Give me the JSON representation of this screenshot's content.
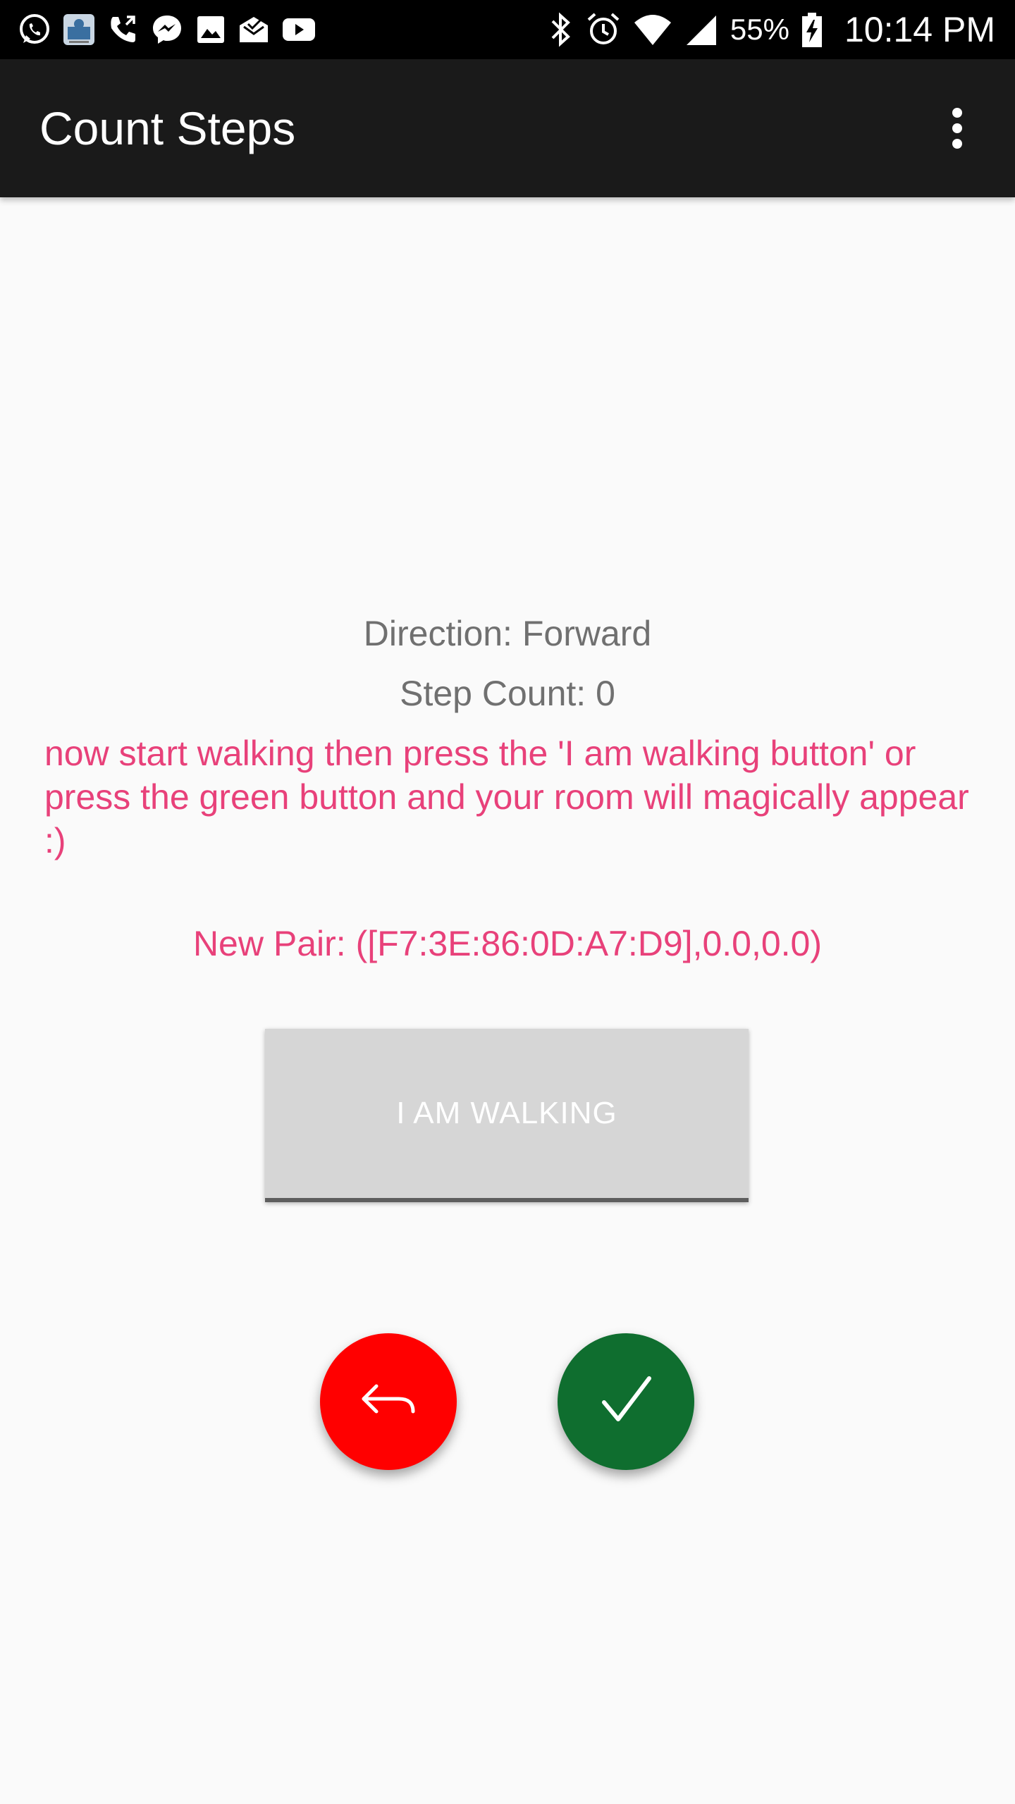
{
  "status_bar": {
    "battery_percent": "55%",
    "time": "10:14 PM",
    "icons": [
      "whatsapp-icon",
      "app-thumbnail-icon",
      "phone-call-icon",
      "messenger-icon",
      "gallery-icon",
      "mail-icon",
      "youtube-icon",
      "bluetooth-icon",
      "alarm-icon",
      "wifi-icon",
      "signal-icon",
      "battery-icon"
    ]
  },
  "app_bar": {
    "title": "Count Steps",
    "menu_icon": "more-vert-icon"
  },
  "main": {
    "direction": "Direction: Forward",
    "step_count": "Step Count: 0",
    "instruction": "now start walking  then press the 'I am walking button' or press the green button and your room will magically appear :)",
    "new_pair": "New Pair: ([F7:3E:86:0D:A7:D9],0.0,0.0)",
    "walk_button_label": "I AM WALKING"
  },
  "fabs": {
    "back_icon": "reply-arrow-icon",
    "confirm_icon": "checkmark-icon"
  },
  "colors": {
    "status_bar_bg": "#000000",
    "app_bar_bg": "#1a1a1a",
    "page_bg": "#fafafa",
    "info_text": "#707070",
    "accent_pink": "#e8417a",
    "button_bg": "#d6d6d6",
    "fab_red": "#ff0000",
    "fab_green": "#0f6e2f"
  }
}
